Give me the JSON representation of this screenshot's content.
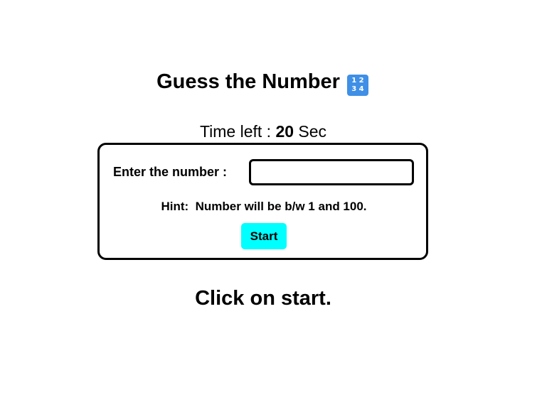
{
  "header": {
    "title": "Guess the Number",
    "title_icon": "input-numbers-icon",
    "title_icon_glyph": "1 2\n3 4"
  },
  "timer": {
    "prefix": "Time left : ",
    "seconds": "20",
    "suffix": " Sec"
  },
  "form": {
    "input_label": "Enter the number :",
    "input_value": "",
    "input_placeholder": "",
    "hint_label": "Hint:",
    "hint_text": "Number will be b/w 1 and 100.",
    "start_label": "Start"
  },
  "status": {
    "message": "Click on start."
  },
  "colors": {
    "start_button_bg": "#00ffff",
    "border": "#000000",
    "icon_bg": "#3f8fe6"
  }
}
